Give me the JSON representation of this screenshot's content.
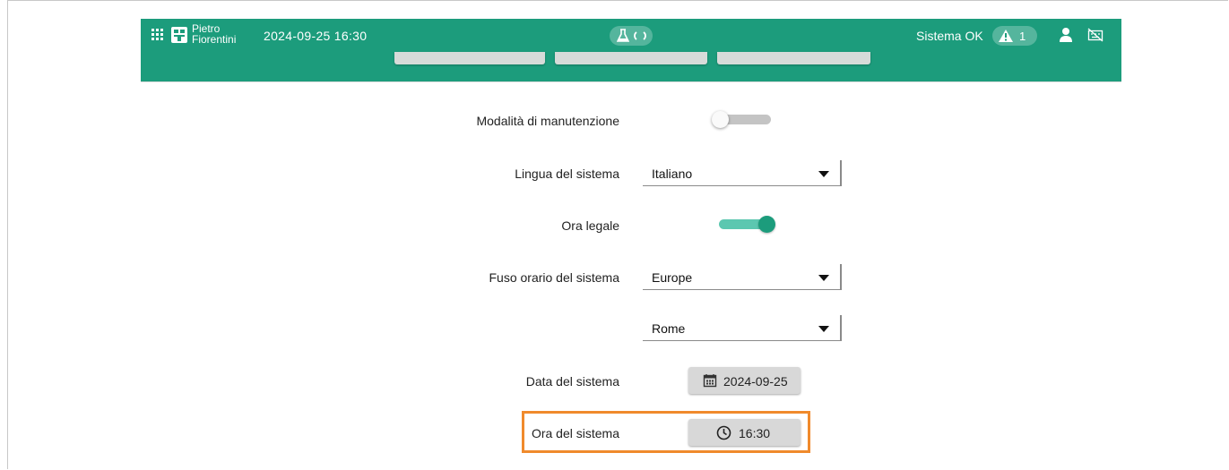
{
  "header": {
    "logo_line1": "Pietro",
    "logo_line2": "Fiorentini",
    "datetime": "2024-09-25 16:30",
    "status": "Sistema OK",
    "alarm_count": "1"
  },
  "settings": {
    "maintenance_label": "Modalità di manutenzione",
    "maintenance_on": false,
    "language_label": "Lingua del sistema",
    "language_value": "Italiano",
    "dst_label": "Ora legale",
    "dst_on": true,
    "timezone_label": "Fuso orario del sistema",
    "timezone_region": "Europe",
    "timezone_city": "Rome",
    "date_label": "Data del sistema",
    "date_value": "2024-09-25",
    "time_label": "Ora del sistema",
    "time_value": "16:30"
  },
  "colors": {
    "brand": "#1c9c7c",
    "toggle_on_track": "#5cc7b0",
    "highlight": "#f08a2c"
  },
  "icons": {
    "apps": "apps-grid-icon",
    "logo": "pietro-fiorentini-logo",
    "lab": "flask-icon",
    "sync": "sync-icon",
    "warning": "warning-icon",
    "user": "user-icon",
    "keyboard": "keyboard-off-icon",
    "calendar": "calendar-icon",
    "clock": "clock-icon"
  }
}
